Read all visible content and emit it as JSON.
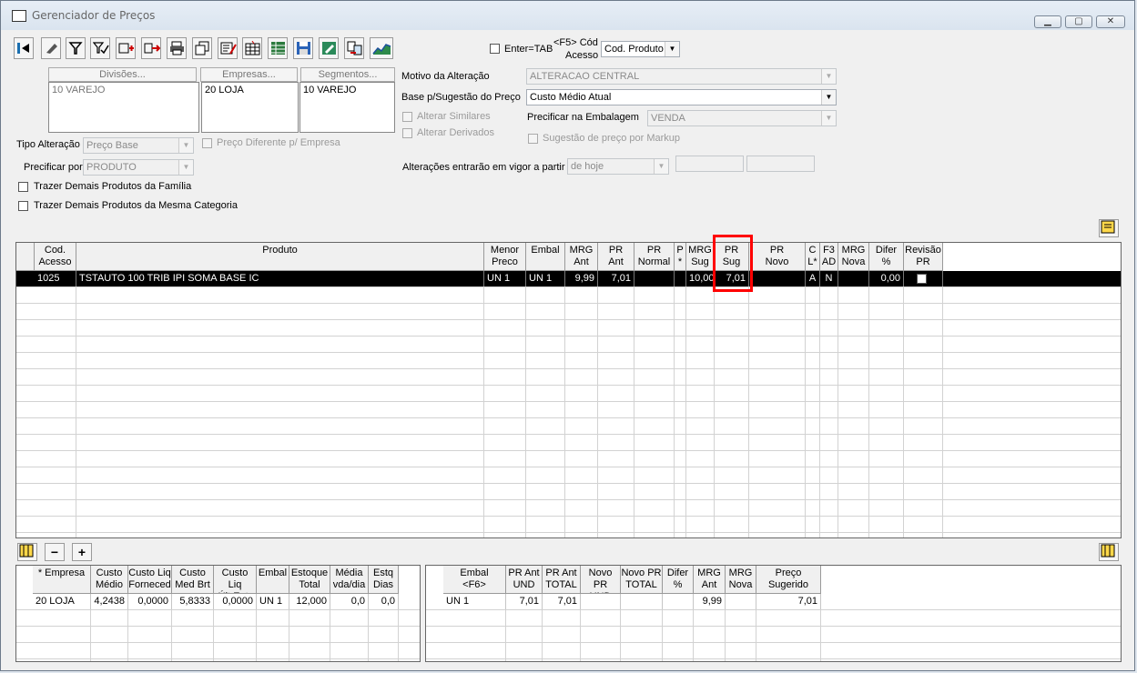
{
  "window": {
    "title": "Gerenciador de Preços",
    "controls": [
      "minimize-icon",
      "maximize-icon",
      "close-icon"
    ]
  },
  "toolbar": {
    "icons": [
      "exit-icon",
      "eraser-icon",
      "filter-icon",
      "filter-check-icon",
      "add-table-icon",
      "export-icon",
      "print-icon",
      "copy-icon",
      "edit-list-icon",
      "grid-icon",
      "spreadsheet-icon",
      "save-icon",
      "edit-form-icon",
      "transfer-icon",
      "chart-icon"
    ],
    "enter_tab_label": "Enter=TAB",
    "f5_label_1": "<F5> Cód",
    "f5_label_2": "Acesso",
    "access_select": "Cod. Produto"
  },
  "filters": {
    "divisoes_header": "Divisões...",
    "empresas_header": "Empresas...",
    "segmentos_header": "Segmentos...",
    "divisoes_value": "10 VAREJO",
    "empresas_value": "20 LOJA",
    "segmentos_value": "10 VAREJO",
    "tipo_alteracao_label": "Tipo Alteração",
    "tipo_alteracao_value": "Preço Base",
    "preco_diferente_label": "Preço Diferente p/ Empresa",
    "precificar_por_label": "Precificar por",
    "precificar_por_value": "PRODUTO",
    "familia_label": "Trazer Demais Produtos da Família",
    "categoria_label": "Trazer Demais Produtos da Mesma Categoria"
  },
  "settings": {
    "motivo_label": "Motivo da Alteração",
    "motivo_value": "ALTERACAO CENTRAL",
    "base_label": "Base p/Sugestão do Preço",
    "base_value": "Custo Médio Atual",
    "similares_label": "Alterar Similares",
    "derivados_label": "Alterar Derivados",
    "embalagem_label": "Precificar na Embalagem",
    "embalagem_value": "VENDA",
    "markup_label": "Sugestão de preço por Markup",
    "vigor_label": "Alterações entrarão em vigor a partir",
    "vigor_value": "de hoje"
  },
  "main_grid": {
    "headers": [
      "Cod.\nAcesso",
      "Produto",
      "Menor\nPreco",
      "Embal",
      "MRG\nAnt",
      "PR\nAnt",
      "PR\nNormal",
      "P\n*",
      "MRG\nSug",
      "PR Sug",
      "PR\nNovo",
      "C\nL*",
      "F3\nAD",
      "MRG\nNova",
      "Difer\n%",
      "Revisão\nPR"
    ],
    "row": [
      "1025",
      "TSTAUTO 100 TRIB IPI SOMA BASE IC",
      "UN 1",
      "UN 1",
      "9,99",
      "7,01",
      "",
      "",
      "10,00",
      "7,01",
      "",
      "A",
      "N",
      "",
      "0,00",
      ""
    ],
    "highlight_color": "#ff0000"
  },
  "bottom_left": {
    "headers": [
      "* Empresa",
      "Custo\nMédio",
      "Custo Liq\nForneced",
      "Custo\nMed Brt",
      "Custo Liq\nÚlt Entr",
      "Embal",
      "Estoque\nTotal",
      "Média\nvda/dia",
      "Estq\nDias"
    ],
    "row": [
      "20 LOJA",
      "4,2438",
      "0,0000",
      "5,8333",
      "0,0000",
      "UN 1",
      "12,000",
      "0,0",
      "0,0"
    ]
  },
  "bottom_right": {
    "headers": [
      "Embal\n<F6>",
      "PR Ant\nUND",
      "PR Ant\nTOTAL",
      "Novo PR\nUND",
      "Novo PR\nTOTAL",
      "Difer\n%",
      "MRG\nAnt",
      "MRG\nNova",
      "Preço\nSugerido"
    ],
    "row": [
      "UN 1",
      "7,01",
      "7,01",
      "",
      "",
      "",
      "9,99",
      "",
      "7,01"
    ]
  }
}
